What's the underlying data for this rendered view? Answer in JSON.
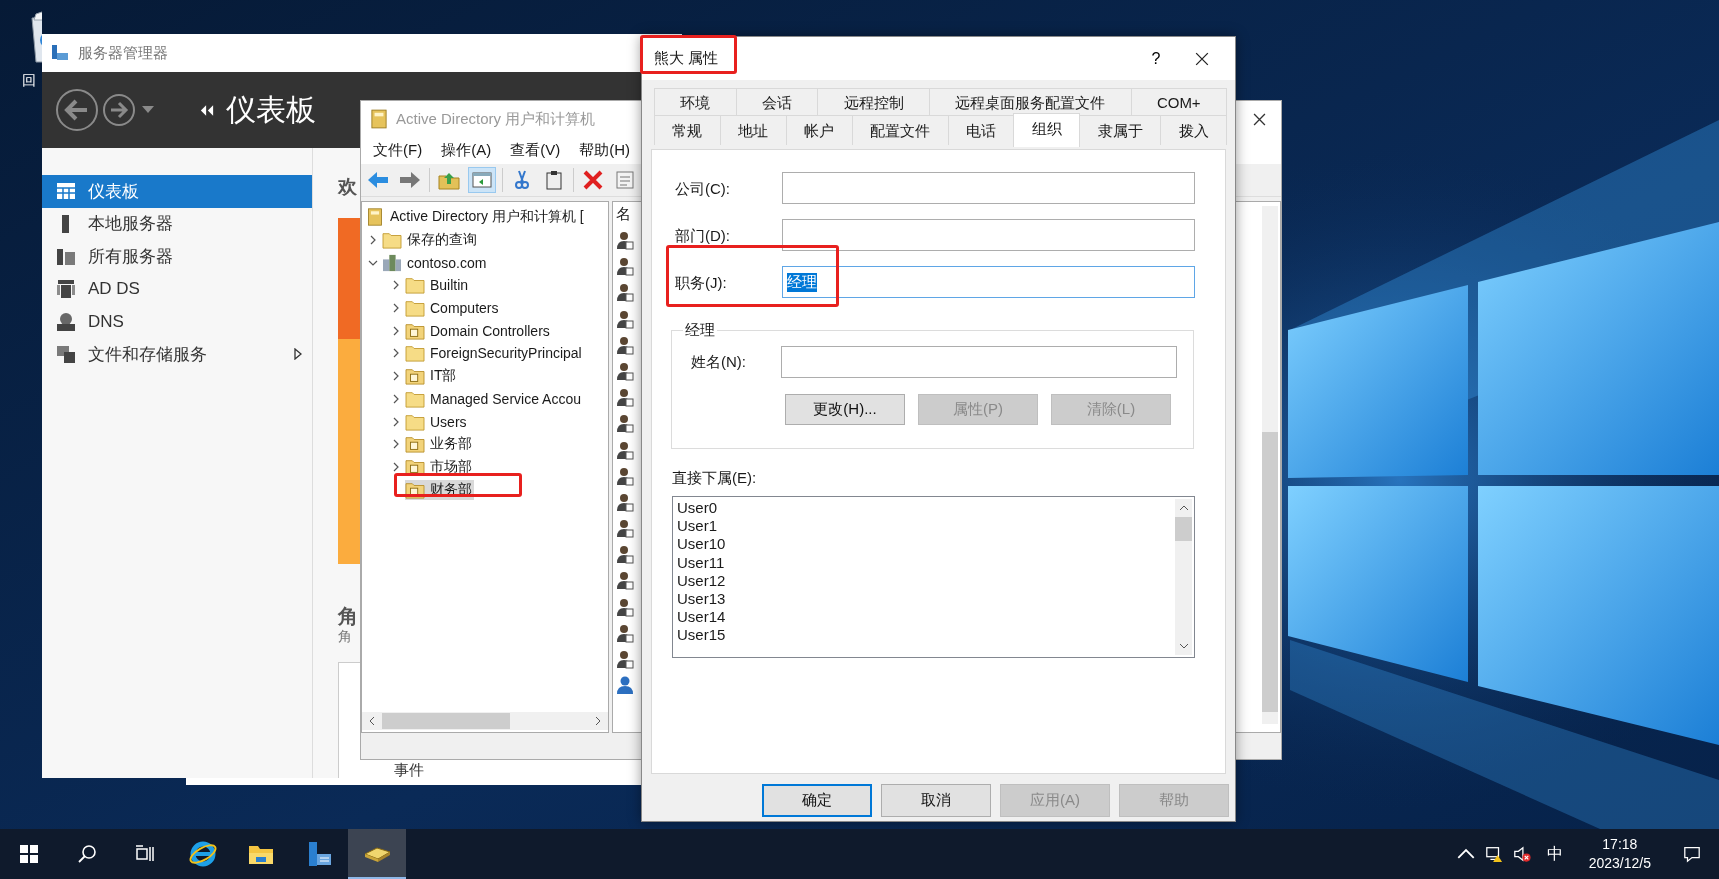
{
  "desktop": {
    "icons": [
      {
        "label": "回"
      }
    ]
  },
  "server_manager": {
    "title": "服务器管理器",
    "header": "仪表板",
    "sidebar": [
      {
        "label": "仪表板",
        "kind": "dashboard",
        "selected": true,
        "submenu": false
      },
      {
        "label": "本地服务器",
        "kind": "server",
        "selected": false,
        "submenu": false
      },
      {
        "label": "所有服务器",
        "kind": "servers",
        "selected": false,
        "submenu": false
      },
      {
        "label": "AD DS",
        "kind": "adds",
        "selected": false,
        "submenu": false
      },
      {
        "label": "DNS",
        "kind": "dns",
        "selected": false,
        "submenu": false
      },
      {
        "label": "文件和存储服务",
        "kind": "storage",
        "selected": false,
        "submenu": true
      }
    ],
    "content": {
      "heading": "欢",
      "section_title": "角",
      "section_subtitle": "角",
      "panel_title": "事件"
    }
  },
  "ad_window": {
    "title": "Active Directory 用户和计算机",
    "menu": [
      "文件(F)",
      "操作(A)",
      "查看(V)",
      "帮助(H)"
    ],
    "tree": {
      "label": "Active Directory 用户和计算机 [",
      "children": [
        {
          "label": "保存的查询",
          "kind": "folder",
          "expandable": true,
          "expanded": false,
          "selected": false
        },
        {
          "label": "contoso.com",
          "kind": "domain",
          "expandable": true,
          "expanded": true,
          "selected": false,
          "children": [
            {
              "label": "Builtin",
              "kind": "folder",
              "expandable": true,
              "expanded": false,
              "selected": false
            },
            {
              "label": "Computers",
              "kind": "folder",
              "expandable": true,
              "expanded": false,
              "selected": false
            },
            {
              "label": "Domain Controllers",
              "kind": "ou",
              "expandable": true,
              "expanded": false,
              "selected": false
            },
            {
              "label": "ForeignSecurityPrincipal",
              "kind": "folder",
              "expandable": true,
              "expanded": false,
              "selected": false
            },
            {
              "label": "IT部",
              "kind": "ou",
              "expandable": true,
              "expanded": false,
              "selected": false
            },
            {
              "label": "Managed Service Accou",
              "kind": "folder",
              "expandable": true,
              "expanded": false,
              "selected": false
            },
            {
              "label": "Users",
              "kind": "folder",
              "expandable": true,
              "expanded": false,
              "selected": false
            },
            {
              "label": "业务部",
              "kind": "ou",
              "expandable": true,
              "expanded": false,
              "selected": false
            },
            {
              "label": "市场部",
              "kind": "ou",
              "expandable": true,
              "expanded": false,
              "selected": false
            },
            {
              "label": "财务部",
              "kind": "ou",
              "expandable": false,
              "selected": true
            }
          ]
        }
      ]
    },
    "list": {
      "column_1": "名"
    }
  },
  "dialog": {
    "title": "熊大 属性",
    "help": "?",
    "tabs_row1": [
      {
        "label": "环境",
        "selected": false
      },
      {
        "label": "会话",
        "selected": false
      },
      {
        "label": "远程控制",
        "selected": false
      },
      {
        "label": "远程桌面服务配置文件",
        "selected": false
      },
      {
        "label": "COM+",
        "selected": false
      }
    ],
    "tabs_row2": [
      {
        "label": "常规",
        "selected": false
      },
      {
        "label": "地址",
        "selected": false
      },
      {
        "label": "帐户",
        "selected": false
      },
      {
        "label": "配置文件",
        "selected": false
      },
      {
        "label": "电话",
        "selected": false
      },
      {
        "label": "组织",
        "selected": true
      },
      {
        "label": "隶属于",
        "selected": false
      },
      {
        "label": "拨入",
        "selected": false
      }
    ],
    "fields": [
      {
        "label": "公司(C):",
        "selected": false
      },
      {
        "label": "部门(D):",
        "selected": false
      },
      {
        "label": "职务(J):",
        "value": "经理",
        "selected": true
      }
    ],
    "manager": {
      "legend": "经理",
      "name_label": "姓名(N):",
      "buttons": [
        {
          "label": "更改(H)...",
          "disabled": false
        },
        {
          "label": "属性(P)",
          "disabled": true
        },
        {
          "label": "清除(L)",
          "disabled": true
        }
      ]
    },
    "direct_reports": {
      "label": "直接下属(E):",
      "items": [
        "User0",
        "User1",
        "User10",
        "User11",
        "User12",
        "User13",
        "User14",
        "User15"
      ]
    },
    "buttons": [
      {
        "label": "确定",
        "disabled": false,
        "default": true
      },
      {
        "label": "取消",
        "disabled": false,
        "default": false
      },
      {
        "label": "应用(A)",
        "disabled": true,
        "default": false
      },
      {
        "label": "帮助",
        "disabled": true,
        "default": false
      }
    ]
  },
  "taskbar": {
    "buttons": [
      {
        "kind": "start",
        "active": false
      },
      {
        "kind": "search",
        "active": false
      },
      {
        "kind": "taskview",
        "active": false
      },
      {
        "kind": "ie",
        "active": false
      },
      {
        "kind": "explorer",
        "active": false
      },
      {
        "kind": "servermanager",
        "active": false
      },
      {
        "kind": "aduc",
        "active": true
      }
    ],
    "tray": {
      "volume_muted": true,
      "ime": "中",
      "time": "17:18",
      "date": "2023/12/5"
    }
  }
}
